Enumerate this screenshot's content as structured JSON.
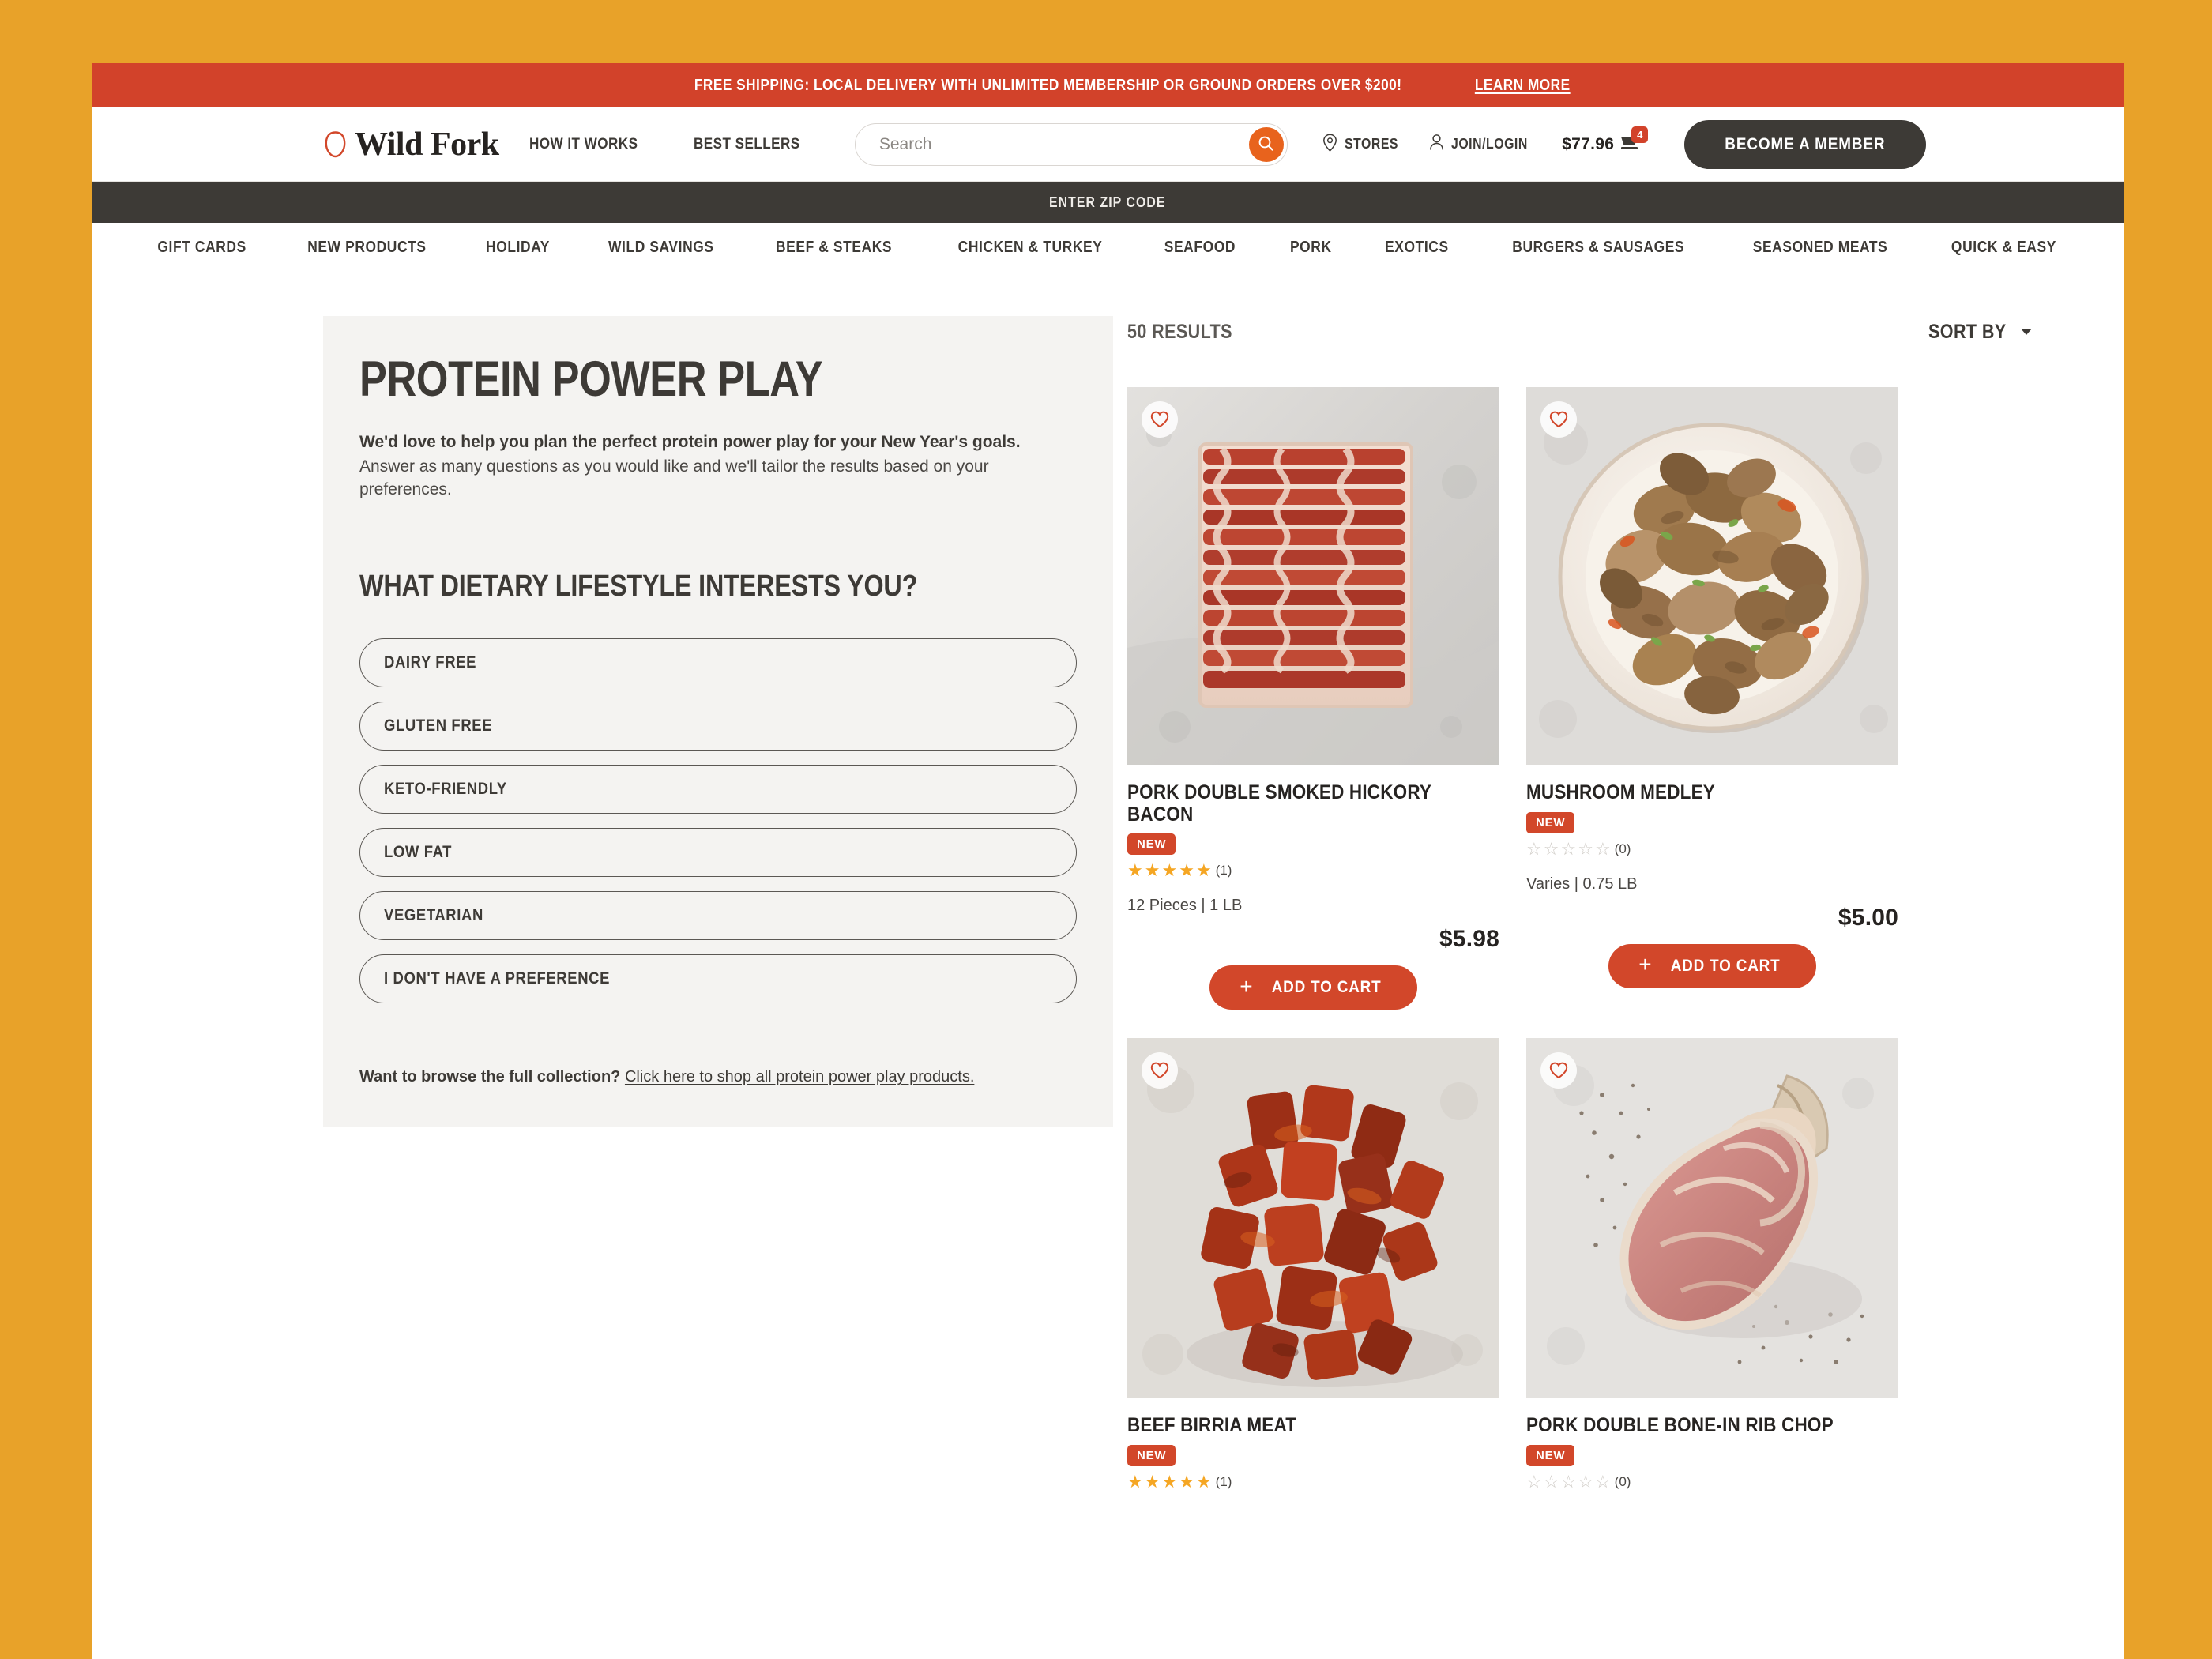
{
  "theme": {
    "page_background": "#e8a229",
    "promo_red": "#d2422a",
    "dark_bar": "#3d3a36",
    "accent_orange": "#e8631d",
    "badge_red": "#d2472a",
    "panel_gray": "#f4f3f1",
    "star_gold": "#f5a623"
  },
  "promo": {
    "text": "FREE SHIPPING: LOCAL DELIVERY WITH UNLIMITED MEMBERSHIP OR GROUND ORDERS OVER $200!",
    "link_label": "LEARN MORE"
  },
  "header": {
    "logo_text": "Wild Fork",
    "nav": [
      {
        "label": "HOW IT WORKS"
      },
      {
        "label": "BEST SELLERS"
      }
    ],
    "search": {
      "placeholder": "Search",
      "value": "",
      "icon": "search-icon"
    },
    "stores_label": "STORES",
    "account_label": "JOIN/LOGIN",
    "cart_total": "$77.96",
    "cart_badge": "4",
    "member_button": "BECOME A MEMBER"
  },
  "zip_bar": {
    "label": "ENTER ZIP CODE"
  },
  "category_nav": [
    {
      "label": "GIFT CARDS"
    },
    {
      "label": "NEW PRODUCTS"
    },
    {
      "label": "HOLIDAY"
    },
    {
      "label": "WILD SAVINGS"
    },
    {
      "label": "BEEF & STEAKS"
    },
    {
      "label": "CHICKEN & TURKEY"
    },
    {
      "label": "SEAFOOD"
    },
    {
      "label": "PORK"
    },
    {
      "label": "EXOTICS"
    },
    {
      "label": "BURGERS & SAUSAGES"
    },
    {
      "label": "SEASONED MEATS"
    },
    {
      "label": "QUICK & EASY"
    }
  ],
  "quiz": {
    "title": "PROTEIN POWER PLAY",
    "lead": "We'd love to help you plan the perfect protein power play for your New Year's goals.",
    "sub": "Answer as many questions as you would like and we'll tailor the results based on your preferences.",
    "question": "WHAT DIETARY LIFESTYLE INTERESTS YOU?",
    "options": [
      {
        "label": "DAIRY FREE"
      },
      {
        "label": "GLUTEN FREE"
      },
      {
        "label": "KETO-FRIENDLY"
      },
      {
        "label": "LOW FAT"
      },
      {
        "label": "VEGETARIAN"
      },
      {
        "label": "I DON'T HAVE A PREFERENCE"
      }
    ],
    "browse_prompt": "Want to browse the full collection?",
    "browse_link": "Click here to shop all protein power play products."
  },
  "results": {
    "count_label": "50 RESULTS",
    "sort_label": "SORT BY",
    "products": [
      {
        "name": "PORK DOUBLE SMOKED HICKORY BACON",
        "badge": "NEW",
        "stars": 5,
        "review_count": "(1)",
        "meta": "12 Pieces | 1 LB",
        "price": "$5.98",
        "cta": "ADD TO CART",
        "image": "bacon-strips-on-marble",
        "favorite_icon": "heart-icon"
      },
      {
        "name": "MUSHROOM MEDLEY",
        "badge": "NEW",
        "stars": 0,
        "review_count": "(0)",
        "meta": "Varies | 0.75 LB",
        "price": "$5.00",
        "cta": "ADD TO CART",
        "image": "mushroom-medley-on-plate",
        "favorite_icon": "heart-icon"
      },
      {
        "name": "BEEF BIRRIA MEAT",
        "badge": "NEW",
        "stars": 5,
        "review_count": "(1)",
        "meta": "",
        "price": "",
        "cta": "",
        "image": "beef-birria-chunks",
        "favorite_icon": "heart-icon"
      },
      {
        "name": "PORK DOUBLE BONE-IN RIB CHOP",
        "badge": "NEW",
        "stars": 0,
        "review_count": "(0)",
        "meta": "",
        "price": "",
        "cta": "",
        "image": "pork-rib-chop",
        "favorite_icon": "heart-icon"
      }
    ]
  }
}
